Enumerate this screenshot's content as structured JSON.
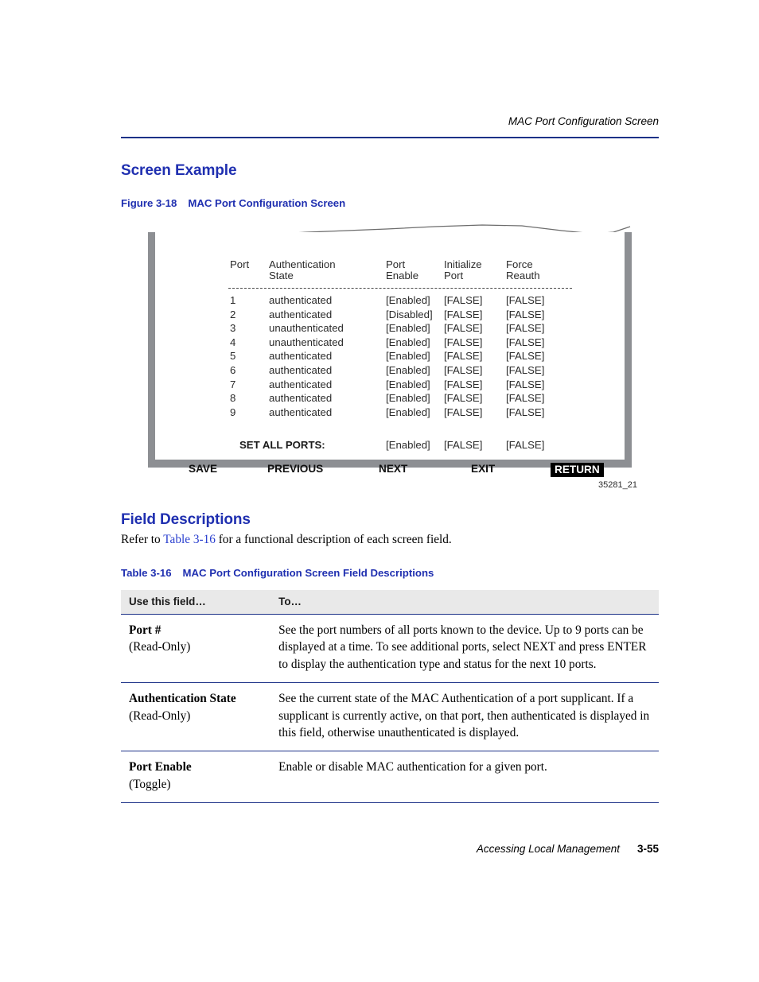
{
  "page": {
    "running_header": "MAC Port Configuration Screen",
    "footer_doc_name": "Accessing Local Management",
    "footer_page_number": "3-55"
  },
  "sections": {
    "screen_example_heading": "Screen Example",
    "field_descriptions_heading": "Field Descriptions",
    "field_descriptions_intro_before": "Refer to ",
    "field_descriptions_intro_link": "Table 3-16",
    "field_descriptions_intro_after": " for a functional description of each screen field."
  },
  "figure": {
    "number": "Figure 3-18",
    "title": "MAC Port Configuration Screen",
    "image_id": "35281_21"
  },
  "terminal": {
    "headers": {
      "port_line1": "Port",
      "port_line2": "",
      "auth_line1": "Authentication",
      "auth_line2": "State",
      "enable_line1": "Port",
      "enable_line2": "Enable",
      "init_line1": "Initialize",
      "init_line2": "Port",
      "force_line1": "Force",
      "force_line2": "Reauth"
    },
    "rows": [
      {
        "port": "1",
        "state": "authenticated",
        "enable": "[Enabled]",
        "init": "[FALSE]",
        "force": "[FALSE]"
      },
      {
        "port": "2",
        "state": "authenticated",
        "enable": "[Disabled]",
        "init": "[FALSE]",
        "force": "[FALSE]"
      },
      {
        "port": "3",
        "state": "unauthenticated",
        "enable": "[Enabled]",
        "init": "[FALSE]",
        "force": "[FALSE]"
      },
      {
        "port": "4",
        "state": "unauthenticated",
        "enable": "[Enabled]",
        "init": "[FALSE]",
        "force": "[FALSE]"
      },
      {
        "port": "5",
        "state": "authenticated",
        "enable": "[Enabled]",
        "init": "[FALSE]",
        "force": "[FALSE]"
      },
      {
        "port": "6",
        "state": "authenticated",
        "enable": "[Enabled]",
        "init": "[FALSE]",
        "force": "[FALSE]"
      },
      {
        "port": "7",
        "state": "authenticated",
        "enable": "[Enabled]",
        "init": "[FALSE]",
        "force": "[FALSE]"
      },
      {
        "port": "8",
        "state": "authenticated",
        "enable": "[Enabled]",
        "init": "[FALSE]",
        "force": "[FALSE]"
      },
      {
        "port": "9",
        "state": "authenticated",
        "enable": "[Enabled]",
        "init": "[FALSE]",
        "force": "[FALSE]"
      }
    ],
    "set_all": {
      "label": "SET ALL PORTS:",
      "enable": "[Enabled]",
      "init": "[FALSE]",
      "force": "[FALSE]"
    },
    "nav": {
      "save": "SAVE",
      "previous": "PREVIOUS",
      "next": "NEXT",
      "exit": "EXIT",
      "return": "RETURN"
    }
  },
  "field_table": {
    "number": "Table 3-16",
    "title": "MAC Port Configuration Screen Field Descriptions",
    "columns": [
      "Use this field…",
      "To…"
    ],
    "rows": [
      {
        "field": "Port #",
        "mode": "(Read-Only)",
        "description": "See the port numbers of all ports known to the device. Up to 9 ports can be displayed at a time. To see additional ports, select NEXT and press ENTER to display the authentication type and status for the next 10 ports."
      },
      {
        "field": "Authentication State",
        "mode": "(Read-Only)",
        "description": "See the current state of the MAC Authentication of a port supplicant. If a supplicant is currently active, on that port, then authenticated is displayed in this field, otherwise unauthenticated is displayed."
      },
      {
        "field": "Port Enable",
        "mode": "(Toggle)",
        "description": "Enable or disable MAC authentication for a given port."
      }
    ]
  },
  "colors": {
    "heading_blue": "#1f2fb0",
    "rule_navy": "#1d3288",
    "link_blue": "#2a3fcf",
    "screen_border_gray": "#8d8f93",
    "table_header_gray": "#e9e9e9"
  }
}
